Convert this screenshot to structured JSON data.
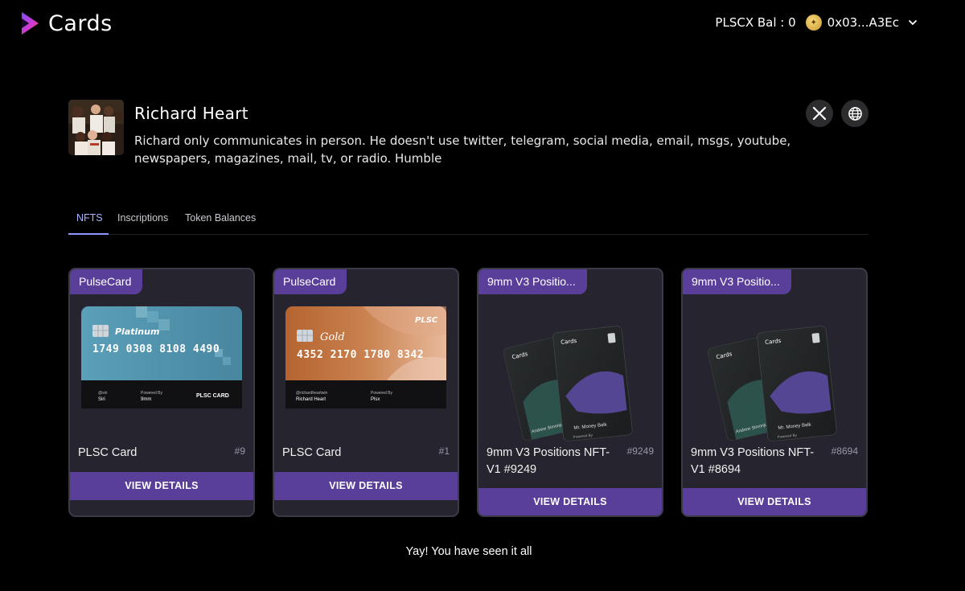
{
  "header": {
    "logo_text": "Cards",
    "balance_text": "PLSCX Bal : 0",
    "address": "0x03...A3Ec"
  },
  "profile": {
    "name": "Richard Heart",
    "bio": "Richard only communicates in person. He doesn't use twitter, telegram, social media, email, msgs, youtube, newspapers, magazines, mail, tv, or radio. Humble"
  },
  "tabs": [
    {
      "label": "NFTS",
      "active": true
    },
    {
      "label": "Inscriptions",
      "active": false
    },
    {
      "label": "Token Balances",
      "active": false
    }
  ],
  "cards": [
    {
      "badge": "PulseCard",
      "title": "PLSC Card",
      "number": "#9",
      "button": "VIEW DETAILS",
      "image": {
        "tier": "Platinum",
        "card_number": "1749 0308 8108 4490",
        "holder_handle": "@siri",
        "holder_name": "Siri",
        "powered_label": "Powered By",
        "powered_by": "9mm",
        "brand": "PLSC CARD"
      }
    },
    {
      "badge": "PulseCard",
      "title": "PLSC Card",
      "number": "#1",
      "button": "VIEW DETAILS",
      "image": {
        "tier": "Gold",
        "card_number": "4352 2170 1780 8342",
        "holder_handle": "@richardheartwin",
        "holder_name": "Richard Heart",
        "powered_label": "Powered By",
        "powered_by": "Plsx",
        "brand": "PLSC"
      }
    },
    {
      "badge": "9mm V3 Positio...",
      "title": "9mm V3 Positions NFT-V1 #9249",
      "number": "#9249",
      "button": "VIEW DETAILS",
      "image": {
        "brand": "Cards",
        "front_name": "Mr. Money Balk",
        "back_name": "Andrew Simonjun",
        "powered": "Powered By"
      }
    },
    {
      "badge": "9mm V3 Positio...",
      "title": "9mm V3 Positions NFT-V1 #8694",
      "number": "#8694",
      "button": "VIEW DETAILS",
      "image": {
        "brand": "Cards",
        "front_name": "Mr. Money Balk",
        "back_name": "Andrew Simonjun",
        "powered": "Powered By"
      }
    }
  ],
  "footer": {
    "end_message": "Yay! You have seen it all"
  },
  "colors": {
    "background": "#000000",
    "card_bg": "#26242e",
    "accent_purple": "#5a3f9a",
    "active_tab": "#a9b4ff",
    "platinum_card": "#4f93ad",
    "gold_card": "#b96b3c"
  },
  "icons": [
    "cards-logo-icon",
    "coin-icon",
    "chevron-down-icon",
    "x-twitter-icon",
    "globe-icon",
    "chip-icon"
  ]
}
